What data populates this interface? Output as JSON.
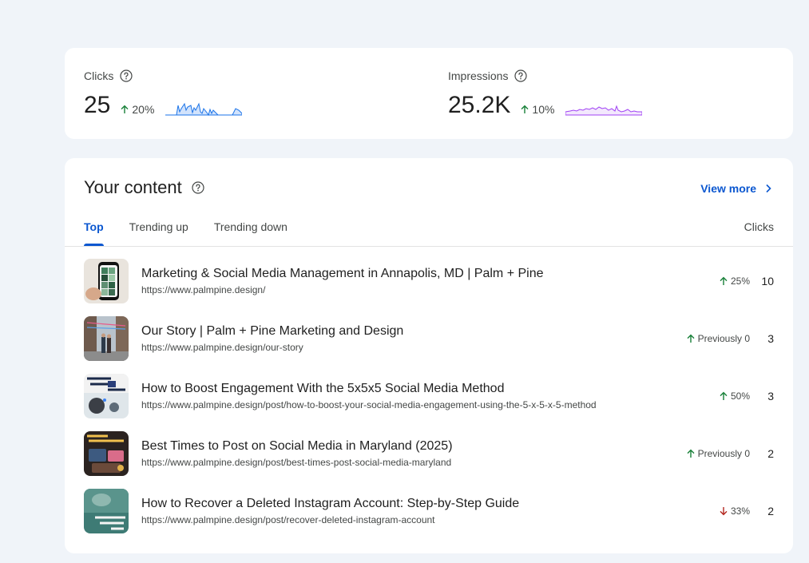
{
  "metrics": {
    "clicks": {
      "label": "Clicks",
      "value": "25",
      "change": "20%",
      "direction": "up",
      "spark_color": "#1a73e8",
      "spark_fill": "#d2e3fc"
    },
    "impressions": {
      "label": "Impressions",
      "value": "25.2K",
      "change": "10%",
      "direction": "up",
      "spark_color": "#a142f4",
      "spark_fill": "#f3e8fd"
    }
  },
  "content": {
    "title": "Your content",
    "view_more": "View more",
    "tabs": [
      {
        "label": "Top",
        "active": true
      },
      {
        "label": "Trending up",
        "active": false
      },
      {
        "label": "Trending down",
        "active": false
      }
    ],
    "column_header": "Clicks",
    "rows": [
      {
        "title": "Marketing & Social Media Management in Annapolis, MD | Palm + Pine",
        "url": "https://www.palmpine.design/",
        "change": "25%",
        "direction": "up",
        "clicks": "10"
      },
      {
        "title": "Our Story | Palm + Pine Marketing and Design",
        "url": "https://www.palmpine.design/our-story",
        "change": "Previously 0",
        "direction": "up",
        "clicks": "3"
      },
      {
        "title": "How to Boost Engagement With the 5x5x5 Social Media Method",
        "url": "https://www.palmpine.design/post/how-to-boost-your-social-media-engagement-using-the-5-x-5-x-5-method",
        "change": "50%",
        "direction": "up",
        "clicks": "3"
      },
      {
        "title": "Best Times to Post on Social Media in Maryland (2025)",
        "url": "https://www.palmpine.design/post/best-times-post-social-media-maryland",
        "change": "Previously 0",
        "direction": "up",
        "clicks": "2"
      },
      {
        "title": "How to Recover a Deleted Instagram Account: Step-by-Step Guide",
        "url": "https://www.palmpine.design/post/recover-deleted-instagram-account",
        "change": "33%",
        "direction": "down",
        "clicks": "2"
      }
    ]
  },
  "colors": {
    "accent": "#0b57d0",
    "up": "#188038",
    "down": "#b3261e"
  },
  "icons": {
    "help": "help-circle-icon",
    "up": "arrow-up-icon",
    "down": "arrow-down-icon",
    "chevron": "chevron-right-icon"
  }
}
